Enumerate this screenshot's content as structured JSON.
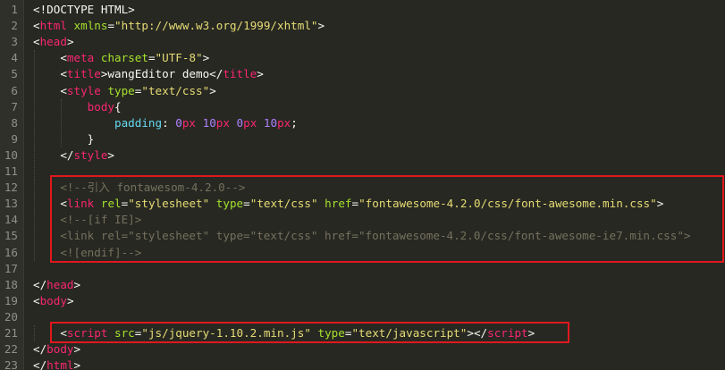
{
  "colors": {
    "background": "#272822",
    "text": "#f8f8f2",
    "tag": "#f92672",
    "attr": "#a6e22e",
    "string": "#e6db74",
    "number": "#ae81ff",
    "property": "#66d9ef",
    "comment": "#75715e",
    "line_number": "#8f908a",
    "highlight_box": "#e0181e"
  },
  "lines": [
    {
      "num": "1",
      "tokens": [
        {
          "t": "<!DOCTYPE HTML>",
          "c": "text"
        }
      ]
    },
    {
      "num": "2",
      "tokens": [
        {
          "t": "<",
          "c": "text"
        },
        {
          "t": "html",
          "c": "tag"
        },
        {
          "t": " ",
          "c": "text"
        },
        {
          "t": "xmlns",
          "c": "attr"
        },
        {
          "t": "=",
          "c": "text"
        },
        {
          "t": "\"http://www.w3.org/1999/xhtml\"",
          "c": "string"
        },
        {
          "t": ">",
          "c": "text"
        }
      ]
    },
    {
      "num": "3",
      "tokens": [
        {
          "t": "<",
          "c": "text"
        },
        {
          "t": "head",
          "c": "tag"
        },
        {
          "t": ">",
          "c": "text"
        }
      ]
    },
    {
      "num": "4",
      "tokens": [
        {
          "t": "    <",
          "c": "text"
        },
        {
          "t": "meta",
          "c": "tag"
        },
        {
          "t": " ",
          "c": "text"
        },
        {
          "t": "charset",
          "c": "attr"
        },
        {
          "t": "=",
          "c": "text"
        },
        {
          "t": "\"UTF-8\"",
          "c": "string"
        },
        {
          "t": ">",
          "c": "text"
        }
      ]
    },
    {
      "num": "5",
      "tokens": [
        {
          "t": "    <",
          "c": "text"
        },
        {
          "t": "title",
          "c": "tag"
        },
        {
          "t": ">wangEditor demo</",
          "c": "text"
        },
        {
          "t": "title",
          "c": "tag"
        },
        {
          "t": ">",
          "c": "text"
        }
      ]
    },
    {
      "num": "6",
      "tokens": [
        {
          "t": "    <",
          "c": "text"
        },
        {
          "t": "style",
          "c": "tag"
        },
        {
          "t": " ",
          "c": "text"
        },
        {
          "t": "type",
          "c": "attr"
        },
        {
          "t": "=",
          "c": "text"
        },
        {
          "t": "\"text/css\"",
          "c": "string"
        },
        {
          "t": ">",
          "c": "text"
        }
      ]
    },
    {
      "num": "7",
      "tokens": [
        {
          "t": "        ",
          "c": "text"
        },
        {
          "t": "body",
          "c": "tag"
        },
        {
          "t": "{",
          "c": "text"
        }
      ]
    },
    {
      "num": "8",
      "tokens": [
        {
          "t": "            ",
          "c": "text"
        },
        {
          "t": "padding",
          "c": "property"
        },
        {
          "t": ": ",
          "c": "text"
        },
        {
          "t": "0",
          "c": "number"
        },
        {
          "t": "px",
          "c": "tag"
        },
        {
          "t": " ",
          "c": "text"
        },
        {
          "t": "10",
          "c": "number"
        },
        {
          "t": "px",
          "c": "tag"
        },
        {
          "t": " ",
          "c": "text"
        },
        {
          "t": "0",
          "c": "number"
        },
        {
          "t": "px",
          "c": "tag"
        },
        {
          "t": " ",
          "c": "text"
        },
        {
          "t": "10",
          "c": "number"
        },
        {
          "t": "px",
          "c": "tag"
        },
        {
          "t": ";",
          "c": "text"
        }
      ]
    },
    {
      "num": "9",
      "tokens": [
        {
          "t": "        }",
          "c": "text"
        }
      ]
    },
    {
      "num": "10",
      "tokens": [
        {
          "t": "    </",
          "c": "text"
        },
        {
          "t": "style",
          "c": "tag"
        },
        {
          "t": ">",
          "c": "text"
        }
      ]
    },
    {
      "num": "11",
      "tokens": []
    },
    {
      "num": "12",
      "tokens": [
        {
          "t": "    ",
          "c": "text"
        },
        {
          "t": "<!--引入 fontawesom-4.2.0-->",
          "c": "comment"
        }
      ]
    },
    {
      "num": "13",
      "tokens": [
        {
          "t": "    <",
          "c": "text"
        },
        {
          "t": "link",
          "c": "tag"
        },
        {
          "t": " ",
          "c": "text"
        },
        {
          "t": "rel",
          "c": "attr"
        },
        {
          "t": "=",
          "c": "text"
        },
        {
          "t": "\"stylesheet\"",
          "c": "string"
        },
        {
          "t": " ",
          "c": "text"
        },
        {
          "t": "type",
          "c": "attr"
        },
        {
          "t": "=",
          "c": "text"
        },
        {
          "t": "\"text/css\"",
          "c": "string"
        },
        {
          "t": " ",
          "c": "text"
        },
        {
          "t": "href",
          "c": "attr"
        },
        {
          "t": "=",
          "c": "text"
        },
        {
          "t": "\"fontawesome-4.2.0/css/font-awesome.min.css\"",
          "c": "string"
        },
        {
          "t": ">",
          "c": "text"
        }
      ]
    },
    {
      "num": "14",
      "tokens": [
        {
          "t": "    ",
          "c": "text"
        },
        {
          "t": "<!--[if IE]>",
          "c": "comment"
        }
      ]
    },
    {
      "num": "15",
      "tokens": [
        {
          "t": "    ",
          "c": "text"
        },
        {
          "t": "<link rel=\"stylesheet\" type=\"text/css\" href=\"fontawesome-4.2.0/css/font-awesome-ie7.min.css\">",
          "c": "comment"
        }
      ]
    },
    {
      "num": "16",
      "tokens": [
        {
          "t": "    ",
          "c": "text"
        },
        {
          "t": "<![endif]-->",
          "c": "comment"
        }
      ]
    },
    {
      "num": "17",
      "tokens": []
    },
    {
      "num": "18",
      "tokens": [
        {
          "t": "</",
          "c": "text"
        },
        {
          "t": "head",
          "c": "tag"
        },
        {
          "t": ">",
          "c": "text"
        }
      ]
    },
    {
      "num": "19",
      "tokens": [
        {
          "t": "<",
          "c": "text"
        },
        {
          "t": "body",
          "c": "tag"
        },
        {
          "t": ">",
          "c": "text"
        }
      ]
    },
    {
      "num": "20",
      "tokens": []
    },
    {
      "num": "21",
      "tokens": [
        {
          "t": "    <",
          "c": "text"
        },
        {
          "t": "script",
          "c": "tag"
        },
        {
          "t": " ",
          "c": "text"
        },
        {
          "t": "src",
          "c": "attr"
        },
        {
          "t": "=",
          "c": "text"
        },
        {
          "t": "\"js/jquery-1.10.2.min.js\"",
          "c": "string"
        },
        {
          "t": " ",
          "c": "text"
        },
        {
          "t": "type",
          "c": "attr"
        },
        {
          "t": "=",
          "c": "text"
        },
        {
          "t": "\"text/javascript\"",
          "c": "string"
        },
        {
          "t": "></",
          "c": "text"
        },
        {
          "t": "script",
          "c": "tag"
        },
        {
          "t": ">",
          "c": "text"
        }
      ]
    },
    {
      "num": "22",
      "tokens": [
        {
          "t": "</",
          "c": "text"
        },
        {
          "t": "body",
          "c": "tag"
        },
        {
          "t": ">",
          "c": "text"
        }
      ]
    },
    {
      "num": "23",
      "tokens": [
        {
          "t": "</",
          "c": "text"
        },
        {
          "t": "html",
          "c": "tag"
        },
        {
          "t": ">",
          "c": "text"
        }
      ]
    }
  ]
}
